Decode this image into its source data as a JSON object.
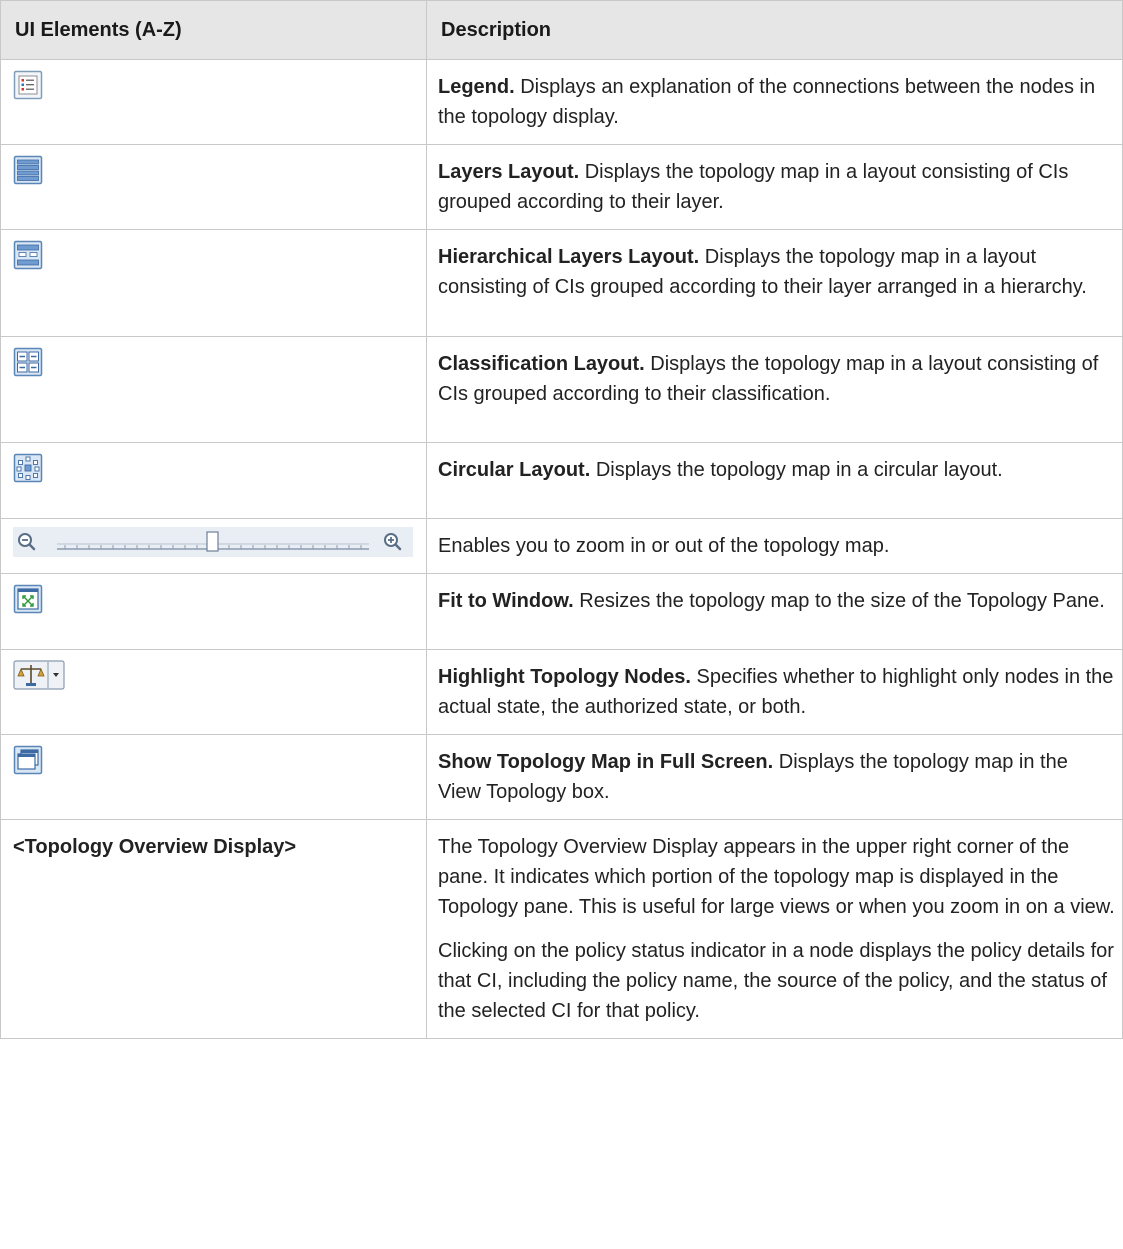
{
  "header": {
    "col1": "UI Elements (A-Z)",
    "col2": "Description"
  },
  "rows": [
    {
      "icon": "legend-icon",
      "term": "Legend.",
      "text": " Displays an explanation of the connections between the nodes in the topology display."
    },
    {
      "icon": "layers-layout-icon",
      "term": "Layers Layout.",
      "text": " Displays the topology map in a layout consisting of CIs grouped according to their layer."
    },
    {
      "icon": "hierarchical-layers-layout-icon",
      "term": "Hierarchical Layers Layout.",
      "text": " Displays the topology map in a layout consisting of CIs grouped according to their layer arranged in a hierarchy."
    },
    {
      "icon": "classification-layout-icon",
      "term": "Classification Layout.",
      "text": " Displays the topology map in a layout consisting of CIs grouped according to their classification."
    },
    {
      "icon": "circular-layout-icon",
      "term": "Circular Layout.",
      "text": " Displays the topology map in a circular layout."
    },
    {
      "icon": "zoom-slider",
      "term": "",
      "text": "Enables you to zoom in or out of the topology map."
    },
    {
      "icon": "fit-to-window-icon",
      "term": "Fit to Window.",
      "text": " Resizes the topology map to the size of the Topology Pane."
    },
    {
      "icon": "highlight-nodes-icon",
      "term": "Highlight Topology Nodes.",
      "text": " Specifies whether to highlight only nodes in the actual state, the authorized state, or both."
    },
    {
      "icon": "full-screen-icon",
      "term": "Show Topology Map in Full Screen.",
      "text": " Displays the topology map in the View Topology box."
    },
    {
      "element": "<Topology Overview Display>",
      "paragraphs": [
        "The Topology Overview Display appears in the upper right corner of the pane. It indicates which portion of the topology map is displayed in the Topology pane. This is useful for large views or when you zoom in on a view.",
        "Clicking on the policy status indicator in a node displays the policy details for that CI, including the policy name, the source of the policy, and the status of the selected CI for that policy."
      ]
    }
  ]
}
